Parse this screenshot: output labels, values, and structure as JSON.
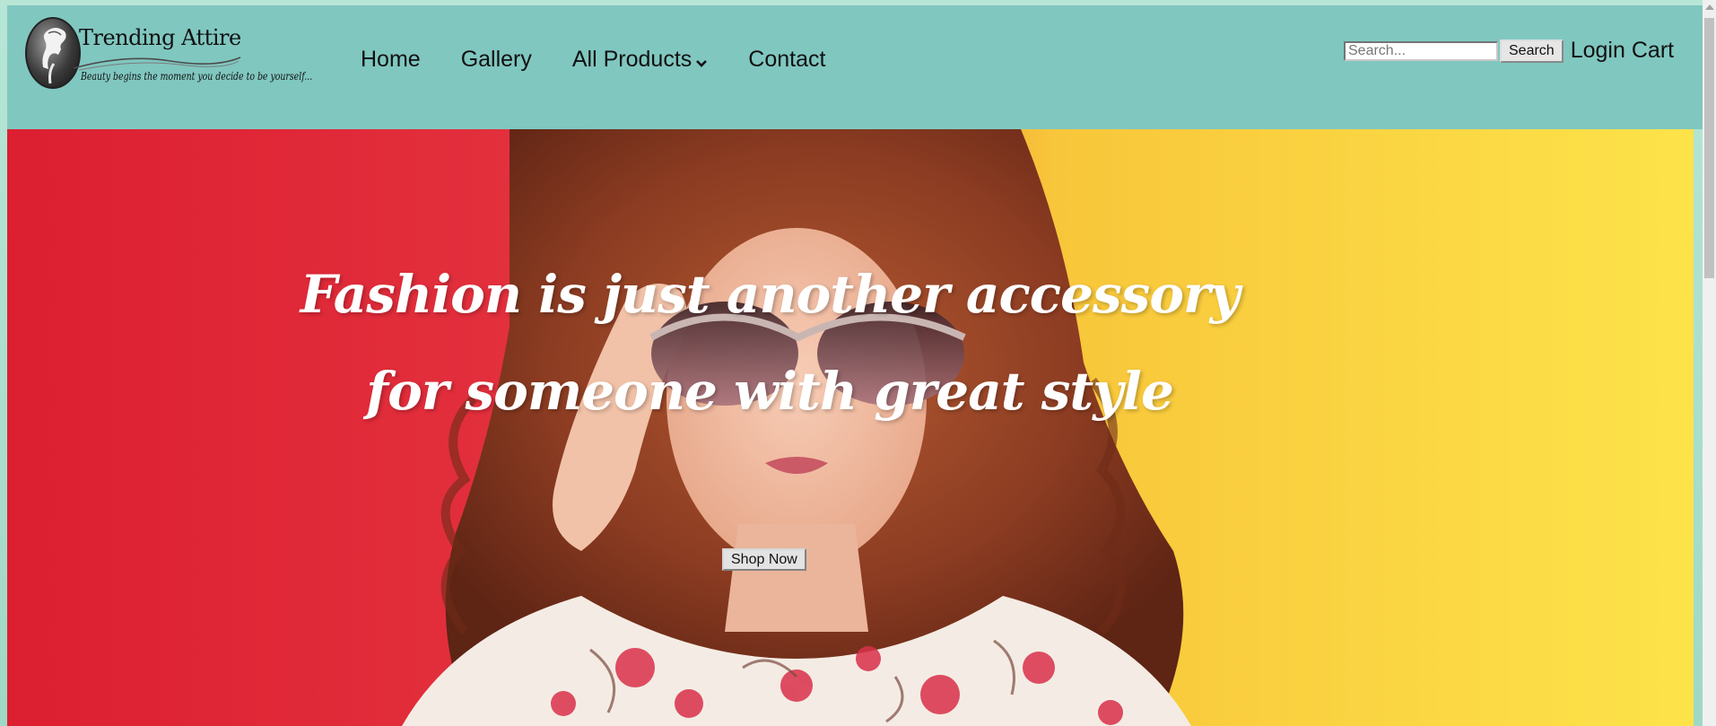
{
  "brand": {
    "name": "Trending Attire",
    "tagline": "Beauty begins the moment you decide to be yourself...",
    "logo_icon": "lady-silhouette-icon"
  },
  "nav": {
    "items": [
      {
        "label": "Home"
      },
      {
        "label": "Gallery"
      },
      {
        "label": "All Products",
        "icon": "chevron-down-icon"
      },
      {
        "label": "Contact"
      }
    ]
  },
  "search": {
    "placeholder": "Search...",
    "value": "",
    "button_label": "Search"
  },
  "account": {
    "login_label": "Login",
    "cart_label": "Cart"
  },
  "hero": {
    "heading_line1": "Fashion is just another accessory",
    "heading_line2": "for someone with great style",
    "cta_label": "Shop Now"
  },
  "colors": {
    "header_bg": "#80c7c0",
    "hero_left": "#dc1f31",
    "hero_right": "#fde34a",
    "heading_text": "#ffffff"
  }
}
